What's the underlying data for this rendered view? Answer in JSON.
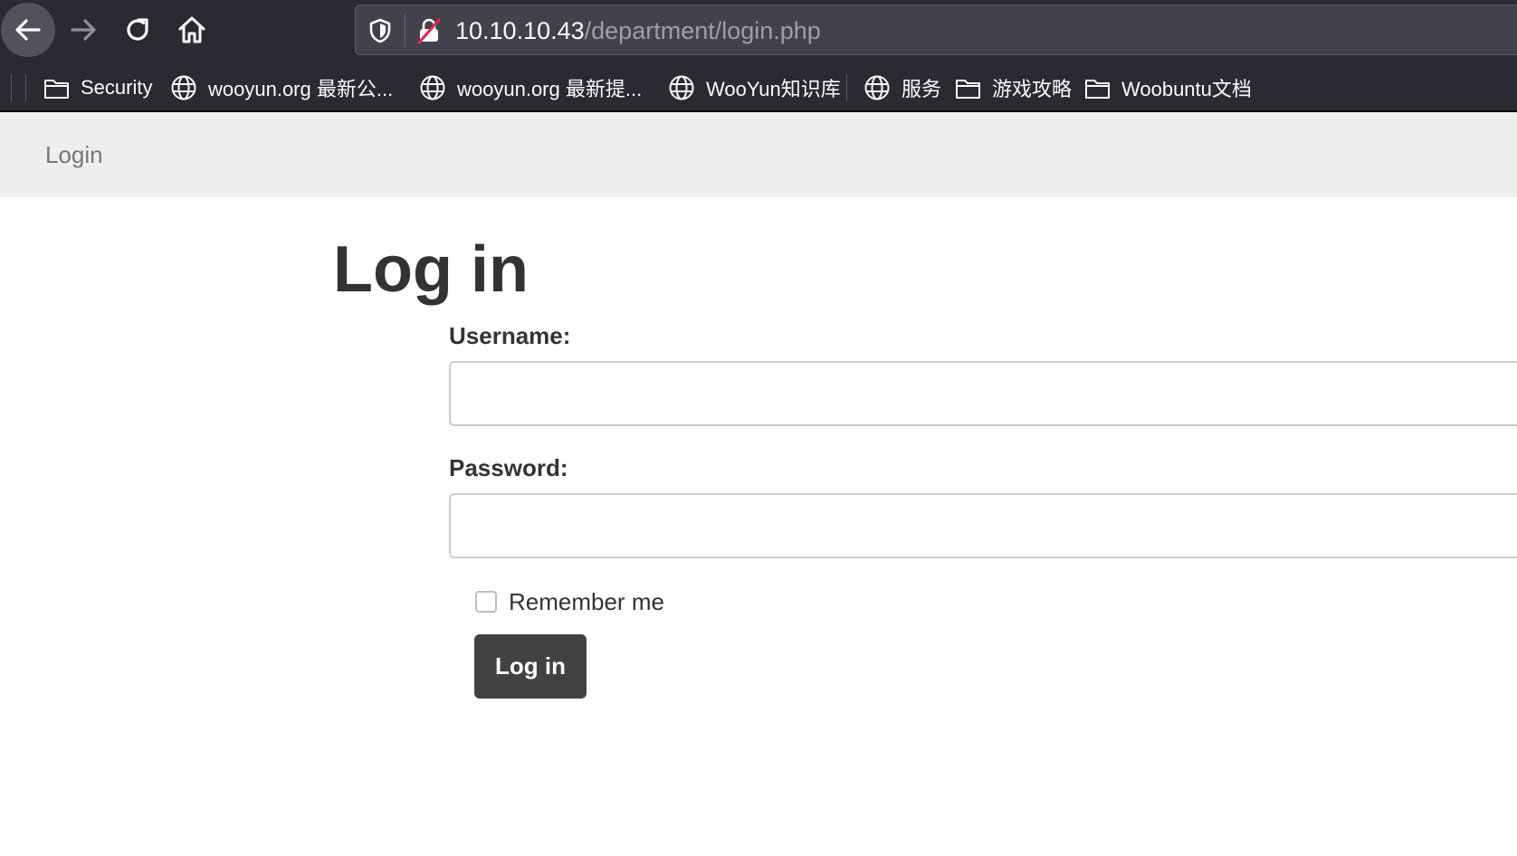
{
  "browser": {
    "url_host": "10.10.10.43",
    "url_path": "/department/login.php",
    "bookmarks": [
      {
        "icon": "folder-icon",
        "label": "Security"
      },
      {
        "icon": "globe-icon",
        "label": "wooyun.org 最新公..."
      },
      {
        "icon": "globe-icon",
        "label": "wooyun.org 最新提..."
      },
      {
        "icon": "globe-icon",
        "label": "WooYun知识库"
      },
      {
        "icon": "globe-icon",
        "label": "服务"
      },
      {
        "icon": "folder-icon",
        "label": "游戏攻略"
      },
      {
        "icon": "folder-icon",
        "label": "Woobuntu文档"
      }
    ]
  },
  "site_nav": {
    "link": "Login"
  },
  "form": {
    "heading": "Log in",
    "username_label": "Username:",
    "username_value": "",
    "password_label": "Password:",
    "password_value": "",
    "remember_label": "Remember me",
    "remember_checked": false,
    "submit_label": "Log in"
  },
  "colors": {
    "chrome_bg": "#2b2a33",
    "urlbar_bg": "#42414d",
    "nav_bg": "#eeeeee",
    "button_bg": "#424242",
    "text": "#333333"
  }
}
